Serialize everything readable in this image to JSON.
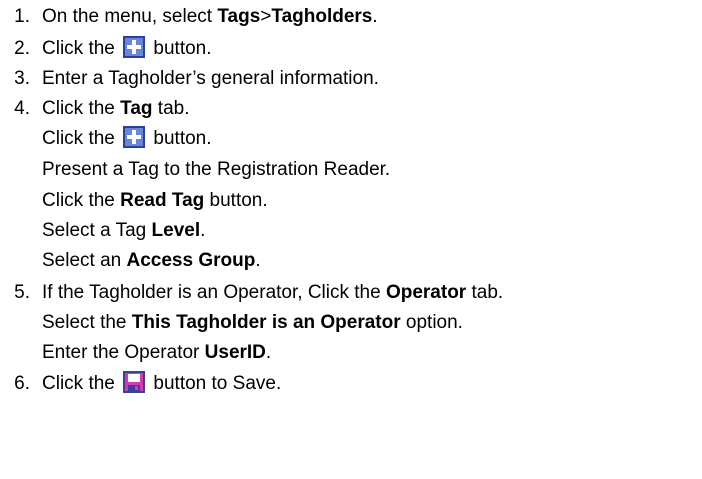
{
  "steps": [
    {
      "num": "1.",
      "parts": [
        "On the menu, select ",
        "Tags",
        ">",
        "Tagholders",
        "."
      ]
    },
    {
      "num": "2.",
      "before": "Click the ",
      "icon": "add-icon",
      "after": " button."
    },
    {
      "num": "3.",
      "text": "Enter a Tagholder’s general information."
    },
    {
      "num": "4.",
      "before": "Click the ",
      "bold": "Tag",
      "after": " tab."
    },
    {
      "num": "5.",
      "before": "If the Tagholder is an Operator, Click the ",
      "bold": "Operator",
      "after": " tab."
    },
    {
      "num": "6.",
      "before": "Click the ",
      "icon": "save-icon",
      "after": " button to Save."
    }
  ],
  "step4_sub": [
    {
      "before": "Click the ",
      "icon": "add-icon",
      "after": " button."
    },
    {
      "text": "Present a Tag to the Registration Reader."
    },
    {
      "before": "Click the ",
      "bold": "Read Tag",
      "after": " button."
    },
    {
      "before": "Select a Tag ",
      "bold": "Level",
      "after": "."
    },
    {
      "before": "Select an ",
      "bold": "Access Group",
      "after": "."
    }
  ],
  "step5_sub": [
    {
      "before": "Select the ",
      "bold": "This Tagholder is an Operator",
      "after": " option."
    },
    {
      "before": "Enter the Operator ",
      "bold": "UserID",
      "after": "."
    }
  ],
  "colors": {
    "add_icon_fill": "#6b86d6",
    "add_icon_border": "#2b3f9e",
    "save_icon_fill": "#d63ab0",
    "save_icon_border": "#3a3f9a"
  }
}
